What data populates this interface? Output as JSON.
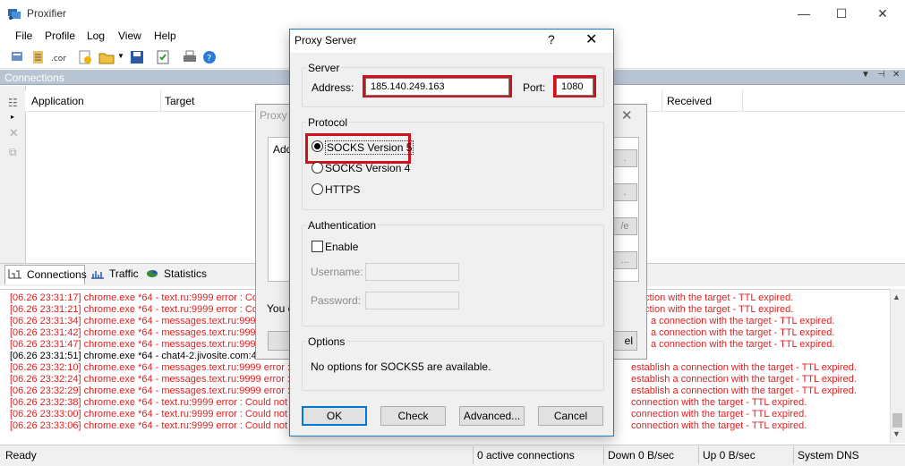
{
  "window": {
    "title": "Proxifier",
    "controls": {
      "minimize": "—",
      "maximize": "☐",
      "close": "✕"
    }
  },
  "menu": [
    "File",
    "Profile",
    "Log",
    "View",
    "Help"
  ],
  "connections_panel": {
    "title": "Connections",
    "columns": [
      "Application",
      "Target",
      "Received"
    ]
  },
  "tabs": [
    "Connections",
    "Traffic",
    "Statistics"
  ],
  "log": {
    "lines": [
      {
        "text": "[06.26 23:31:17] chrome.exe *64 - text.ru:9999 error : Coul",
        "tail": "ction with the target - TTL expired.",
        "type": "err"
      },
      {
        "text": "[06.26 23:31:21] chrome.exe *64 - text.ru:9999 error : Coul",
        "tail": "ction with the target - TTL expired.",
        "type": "err"
      },
      {
        "text": "[06.26 23:31:34] chrome.exe *64 - messages.text.ru:9999 e",
        "tail": "a connection with the target - TTL expired.",
        "type": "err"
      },
      {
        "text": "[06.26 23:31:42] chrome.exe *64 - messages.text.ru:9999 e",
        "tail": "a connection with the target - TTL expired.",
        "type": "err"
      },
      {
        "text": "[06.26 23:31:47] chrome.exe *64 - messages.text.ru:9999 e",
        "tail": "a connection with the target - TTL expired.",
        "type": "err"
      },
      {
        "text": "[06.26 23:31:51] chrome.exe *64 - chat4-2.jivosite.com:44",
        "tail": "",
        "type": "ok"
      },
      {
        "text": "[06.26 23:32:10] chrome.exe *64 - messages.text.ru:9999 error : Co",
        "tail": "establish a connection with the target - TTL expired.",
        "type": "err"
      },
      {
        "text": "[06.26 23:32:24] chrome.exe *64 - messages.text.ru:9999 error : Co",
        "tail": "establish a connection with the target - TTL expired.",
        "type": "err"
      },
      {
        "text": "[06.26 23:32:29] chrome.exe *64 - messages.text.ru:9999 error : Co",
        "tail": "establish a connection with the target - TTL expired.",
        "type": "err"
      },
      {
        "text": "[06.26 23:32:38] chrome.exe *64 - text.ru:9999 error : Could not co",
        "tail": "connection with the target - TTL expired.",
        "type": "err"
      },
      {
        "text": "[06.26 23:33:00] chrome.exe *64 - text.ru:9999 error : Could not co",
        "tail": "connection with the target - TTL expired.",
        "type": "err"
      },
      {
        "text": "[06.26 23:33:06] chrome.exe *64 - text.ru:9999 error : Could not co",
        "tail": "connection with the target - TTL expired.",
        "type": "err"
      }
    ]
  },
  "status": {
    "ready": "Ready",
    "connections": "0 active connections",
    "down": "Down 0 B/sec",
    "up": "Up 0 B/sec",
    "dns": "System DNS"
  },
  "background_dialog": {
    "title_fragment": "Proxy S",
    "box_label_fragment": "Add",
    "hint_fragment": "You c",
    "button_fragments": [
      ".",
      ".",
      "/e",
      "..."
    ],
    "cancel_fragment": "el"
  },
  "dialog": {
    "title": "Proxy Server",
    "help": "?",
    "close": "✕",
    "server": {
      "group_label": "Server",
      "address_label": "Address:",
      "address_value": "185.140.249.163",
      "port_label": "Port:",
      "port_value": "1080"
    },
    "protocol": {
      "group_label": "Protocol",
      "options": [
        "SOCKS Version 5",
        "SOCKS Version 4",
        "HTTPS"
      ],
      "selected": "SOCKS Version 5"
    },
    "authentication": {
      "group_label": "Authentication",
      "enable_label": "Enable",
      "enabled": false,
      "username_label": "Username:",
      "password_label": "Password:"
    },
    "options": {
      "group_label": "Options",
      "text": "No options for SOCKS5 are available."
    },
    "buttons": {
      "ok": "OK",
      "check": "Check",
      "advanced": "Advanced...",
      "cancel": "Cancel"
    }
  },
  "colors": {
    "highlight_red": "#d0111b",
    "log_error": "#e02020",
    "panel_header": "#b9c4d3"
  }
}
